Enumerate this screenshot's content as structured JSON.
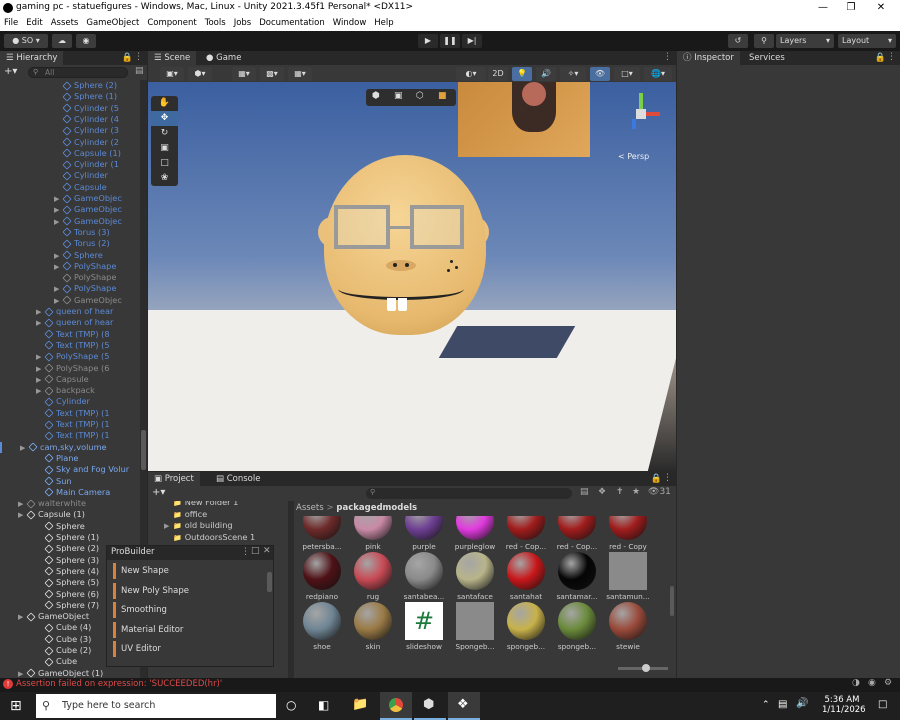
{
  "window": {
    "title": "gaming pc - statuefigures - Windows, Mac, Linux - Unity 2021.3.45f1 Personal* <DX11>"
  },
  "menu": [
    "File",
    "Edit",
    "Assets",
    "GameObject",
    "Component",
    "Tools",
    "Jobs",
    "Documentation",
    "Window",
    "Help"
  ],
  "toolbar": {
    "account": "SO",
    "layers": "Layers",
    "layout": "Layout"
  },
  "hierarchy": {
    "tab": "Hierarchy",
    "search_placeholder": "All",
    "rows": [
      {
        "label": "Sphere (2)",
        "indent": 3,
        "arrow": false,
        "color": "#5b8ad6"
      },
      {
        "label": "Sphere (1)",
        "indent": 3,
        "arrow": false,
        "color": "#5b8ad6"
      },
      {
        "label": "Cylinder (5",
        "indent": 3,
        "arrow": false,
        "color": "#5b8ad6"
      },
      {
        "label": "Cylinder (4",
        "indent": 3,
        "arrow": false,
        "color": "#5b8ad6"
      },
      {
        "label": "Cylinder (3",
        "indent": 3,
        "arrow": false,
        "color": "#5b8ad6"
      },
      {
        "label": "Cylinder (2",
        "indent": 3,
        "arrow": false,
        "color": "#5b8ad6"
      },
      {
        "label": "Capsule (1)",
        "indent": 3,
        "arrow": false,
        "color": "#5b8ad6"
      },
      {
        "label": "Cylinder (1",
        "indent": 3,
        "arrow": false,
        "color": "#5b8ad6"
      },
      {
        "label": "Cylinder",
        "indent": 3,
        "arrow": false,
        "color": "#5b8ad6"
      },
      {
        "label": "Capsule",
        "indent": 3,
        "arrow": false,
        "color": "#5b8ad6"
      },
      {
        "label": "GameObjec",
        "indent": 3,
        "arrow": true,
        "color": "#5b8ad6"
      },
      {
        "label": "GameObjec",
        "indent": 3,
        "arrow": true,
        "color": "#5b8ad6"
      },
      {
        "label": "GameObjec",
        "indent": 3,
        "arrow": true,
        "color": "#5b8ad6"
      },
      {
        "label": "Torus (3)",
        "indent": 3,
        "arrow": false,
        "color": "#5b8ad6"
      },
      {
        "label": "Torus (2)",
        "indent": 3,
        "arrow": false,
        "color": "#5b8ad6"
      },
      {
        "label": "Sphere",
        "indent": 3,
        "arrow": true,
        "color": "#5b8ad6"
      },
      {
        "label": "PolyShape",
        "indent": 3,
        "arrow": true,
        "color": "#5b8ad6"
      },
      {
        "label": "PolyShape",
        "indent": 3,
        "arrow": false,
        "color": "#8a8a8a"
      },
      {
        "label": "PolyShape",
        "indent": 3,
        "arrow": true,
        "color": "#5b8ad6"
      },
      {
        "label": "GameObjec",
        "indent": 3,
        "arrow": true,
        "color": "#8a8a8a"
      },
      {
        "label": "queen of hear",
        "indent": 2,
        "arrow": true,
        "color": "#5b8ad6"
      },
      {
        "label": "queen of hear",
        "indent": 2,
        "arrow": true,
        "color": "#5b8ad6"
      },
      {
        "label": "Text (TMP) (8",
        "indent": 2,
        "arrow": false,
        "color": "#5b8ad6"
      },
      {
        "label": "Text (TMP) (5",
        "indent": 2,
        "arrow": false,
        "color": "#5b8ad6"
      },
      {
        "label": "PolyShape (5",
        "indent": 2,
        "arrow": true,
        "color": "#5b8ad6"
      },
      {
        "label": "PolyShape (6",
        "indent": 2,
        "arrow": true,
        "color": "#8a8a8a"
      },
      {
        "label": "Capsule",
        "indent": 2,
        "arrow": true,
        "color": "#8a8a8a"
      },
      {
        "label": "backpack",
        "indent": 2,
        "arrow": true,
        "color": "#8a8a8a"
      },
      {
        "label": "Cylinder",
        "indent": 2,
        "arrow": false,
        "color": "#5b8ad6"
      },
      {
        "label": "Text (TMP) (1",
        "indent": 2,
        "arrow": false,
        "color": "#5b8ad6"
      },
      {
        "label": "Text (TMP) (1",
        "indent": 2,
        "arrow": false,
        "color": "#5b8ad6"
      },
      {
        "label": "Text (TMP) (1",
        "indent": 2,
        "arrow": false,
        "color": "#5b8ad6"
      },
      {
        "label": "cam,sky,volume",
        "indent": 1,
        "arrow": true,
        "color": "#79a8ee"
      },
      {
        "label": "Plane",
        "indent": 2,
        "arrow": false,
        "color": "#79a8ee"
      },
      {
        "label": "Sky and Fog Volur",
        "indent": 2,
        "arrow": false,
        "color": "#79a8ee"
      },
      {
        "label": "Sun",
        "indent": 2,
        "arrow": false,
        "color": "#79a8ee"
      },
      {
        "label": "Main Camera",
        "indent": 2,
        "arrow": false,
        "color": "#79a8ee"
      },
      {
        "label": "walterwhite",
        "indent": 1,
        "arrow": true,
        "color": "#8a8a8a"
      },
      {
        "label": "Capsule (1)",
        "indent": 1,
        "arrow": true,
        "color": "#d8d8d8"
      },
      {
        "label": "Sphere",
        "indent": 2,
        "arrow": false,
        "color": "#d8d8d8"
      },
      {
        "label": "Sphere (1)",
        "indent": 2,
        "arrow": false,
        "color": "#d8d8d8"
      },
      {
        "label": "Sphere (2)",
        "indent": 2,
        "arrow": false,
        "color": "#d8d8d8"
      },
      {
        "label": "Sphere (3)",
        "indent": 2,
        "arrow": false,
        "color": "#d8d8d8"
      },
      {
        "label": "Sphere (4)",
        "indent": 2,
        "arrow": false,
        "color": "#d8d8d8"
      },
      {
        "label": "Sphere (5)",
        "indent": 2,
        "arrow": false,
        "color": "#d8d8d8"
      },
      {
        "label": "Sphere (6)",
        "indent": 2,
        "arrow": false,
        "color": "#d8d8d8"
      },
      {
        "label": "Sphere (7)",
        "indent": 2,
        "arrow": false,
        "color": "#d8d8d8"
      },
      {
        "label": "GameObject",
        "indent": 1,
        "arrow": true,
        "color": "#d8d8d8"
      },
      {
        "label": "Cube (4)",
        "indent": 2,
        "arrow": false,
        "color": "#d8d8d8"
      },
      {
        "label": "Cube (3)",
        "indent": 2,
        "arrow": false,
        "color": "#d8d8d8"
      },
      {
        "label": "Cube (2)",
        "indent": 2,
        "arrow": false,
        "color": "#d8d8d8"
      },
      {
        "label": "Cube",
        "indent": 2,
        "arrow": false,
        "color": "#d8d8d8"
      },
      {
        "label": "GameObject (1)",
        "indent": 1,
        "arrow": true,
        "color": "#d8d8d8"
      }
    ]
  },
  "scene": {
    "tab_scene": "Scene",
    "tab_game": "Game",
    "persp": "Persp",
    "mode_2d": "2D"
  },
  "inspector": {
    "tab": "Inspector",
    "tab2": "Services"
  },
  "project": {
    "tab": "Project",
    "tab2": "Console",
    "asset_count": "31",
    "breadcrumb_root": "Assets",
    "breadcrumb_folder": "packagedmodels",
    "folders": [
      "New Folder 1",
      "office",
      "old building",
      "OutdoorsScene 1",
      "packagedmodels"
    ],
    "assets": [
      {
        "name": "petersba...",
        "color": "#6e2a2a"
      },
      {
        "name": "pink",
        "color": "#c98aa6"
      },
      {
        "name": "purple",
        "color": "#6e3f93"
      },
      {
        "name": "purpleglow",
        "color": "#e23adf"
      },
      {
        "name": "red - Cop...",
        "color": "#a11c1c"
      },
      {
        "name": "red - Cop...",
        "color": "#a11c1c"
      },
      {
        "name": "red - Copy",
        "color": "#a11c1c"
      },
      {
        "name": "redpiano",
        "color": "#4e1116"
      },
      {
        "name": "rug",
        "color": "#c84a55"
      },
      {
        "name": "santabea...",
        "color": "#8a8a8a"
      },
      {
        "name": "santaface",
        "color": "#b8b48a"
      },
      {
        "name": "santahat",
        "color": "#c8171a"
      },
      {
        "name": "santamar...",
        "color": "#050505"
      },
      {
        "name": "santamun...",
        "color": "#8a8a8a"
      },
      {
        "name": "shoe",
        "color": "#6f8594"
      },
      {
        "name": "skin",
        "color": "#9a7a45"
      },
      {
        "name": "slideshow",
        "color": "#ffffff"
      },
      {
        "name": "Spongeb...",
        "color": "#9a9a9a"
      },
      {
        "name": "spongeb...",
        "color": "#c8b24a"
      },
      {
        "name": "spongeb...",
        "color": "#6a8a3a"
      },
      {
        "name": "stewie",
        "color": "#9a4a3a"
      }
    ]
  },
  "probuilder": {
    "title": "ProBuilder",
    "items": [
      "New Shape",
      "New Poly Shape",
      "Smoothing",
      "Material Editor",
      "UV Editor"
    ]
  },
  "status": {
    "message": "Assertion failed on expression: 'SUCCEEDED(hr)'"
  },
  "taskbar": {
    "search_placeholder": "Type here to search",
    "time": "5:36 AM",
    "date": "1/11/2026"
  }
}
